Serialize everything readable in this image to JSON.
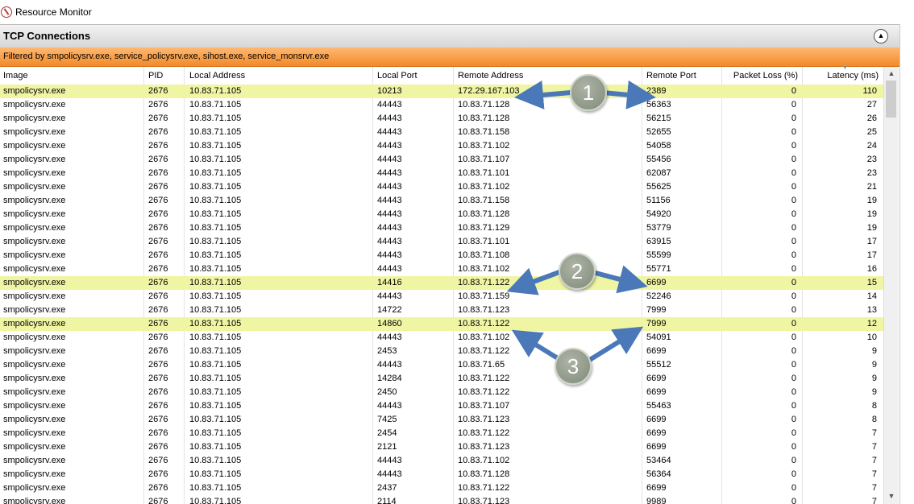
{
  "app": {
    "title": "Resource Monitor"
  },
  "section": {
    "title": "TCP Connections",
    "filter": "Filtered by smpolicysrv.exe, service_policysrv.exe, sihost.exe, service_monsrvr.exe"
  },
  "columns": [
    "Image",
    "PID",
    "Local Address",
    "Local Port",
    "Remote Address",
    "Remote Port",
    "Packet Loss (%)",
    "Latency (ms)"
  ],
  "rows": [
    {
      "image": "smpolicysrv.exe",
      "pid": "2676",
      "local_address": "10.83.71.105",
      "local_port": "10213",
      "remote_address": "172.29.167.103",
      "remote_port": "2389",
      "packet_loss": "0",
      "latency": "110",
      "highlighted": true
    },
    {
      "image": "smpolicysrv.exe",
      "pid": "2676",
      "local_address": "10.83.71.105",
      "local_port": "44443",
      "remote_address": "10.83.71.128",
      "remote_port": "56363",
      "packet_loss": "0",
      "latency": "27",
      "highlighted": false
    },
    {
      "image": "smpolicysrv.exe",
      "pid": "2676",
      "local_address": "10.83.71.105",
      "local_port": "44443",
      "remote_address": "10.83.71.128",
      "remote_port": "56215",
      "packet_loss": "0",
      "latency": "26",
      "highlighted": false
    },
    {
      "image": "smpolicysrv.exe",
      "pid": "2676",
      "local_address": "10.83.71.105",
      "local_port": "44443",
      "remote_address": "10.83.71.158",
      "remote_port": "52655",
      "packet_loss": "0",
      "latency": "25",
      "highlighted": false
    },
    {
      "image": "smpolicysrv.exe",
      "pid": "2676",
      "local_address": "10.83.71.105",
      "local_port": "44443",
      "remote_address": "10.83.71.102",
      "remote_port": "54058",
      "packet_loss": "0",
      "latency": "24",
      "highlighted": false
    },
    {
      "image": "smpolicysrv.exe",
      "pid": "2676",
      "local_address": "10.83.71.105",
      "local_port": "44443",
      "remote_address": "10.83.71.107",
      "remote_port": "55456",
      "packet_loss": "0",
      "latency": "23",
      "highlighted": false
    },
    {
      "image": "smpolicysrv.exe",
      "pid": "2676",
      "local_address": "10.83.71.105",
      "local_port": "44443",
      "remote_address": "10.83.71.101",
      "remote_port": "62087",
      "packet_loss": "0",
      "latency": "23",
      "highlighted": false
    },
    {
      "image": "smpolicysrv.exe",
      "pid": "2676",
      "local_address": "10.83.71.105",
      "local_port": "44443",
      "remote_address": "10.83.71.102",
      "remote_port": "55625",
      "packet_loss": "0",
      "latency": "21",
      "highlighted": false
    },
    {
      "image": "smpolicysrv.exe",
      "pid": "2676",
      "local_address": "10.83.71.105",
      "local_port": "44443",
      "remote_address": "10.83.71.158",
      "remote_port": "51156",
      "packet_loss": "0",
      "latency": "19",
      "highlighted": false
    },
    {
      "image": "smpolicysrv.exe",
      "pid": "2676",
      "local_address": "10.83.71.105",
      "local_port": "44443",
      "remote_address": "10.83.71.128",
      "remote_port": "54920",
      "packet_loss": "0",
      "latency": "19",
      "highlighted": false
    },
    {
      "image": "smpolicysrv.exe",
      "pid": "2676",
      "local_address": "10.83.71.105",
      "local_port": "44443",
      "remote_address": "10.83.71.129",
      "remote_port": "53779",
      "packet_loss": "0",
      "latency": "19",
      "highlighted": false
    },
    {
      "image": "smpolicysrv.exe",
      "pid": "2676",
      "local_address": "10.83.71.105",
      "local_port": "44443",
      "remote_address": "10.83.71.101",
      "remote_port": "63915",
      "packet_loss": "0",
      "latency": "17",
      "highlighted": false
    },
    {
      "image": "smpolicysrv.exe",
      "pid": "2676",
      "local_address": "10.83.71.105",
      "local_port": "44443",
      "remote_address": "10.83.71.108",
      "remote_port": "55599",
      "packet_loss": "0",
      "latency": "17",
      "highlighted": false
    },
    {
      "image": "smpolicysrv.exe",
      "pid": "2676",
      "local_address": "10.83.71.105",
      "local_port": "44443",
      "remote_address": "10.83.71.102",
      "remote_port": "55771",
      "packet_loss": "0",
      "latency": "16",
      "highlighted": false
    },
    {
      "image": "smpolicysrv.exe",
      "pid": "2676",
      "local_address": "10.83.71.105",
      "local_port": "14416",
      "remote_address": "10.83.71.122",
      "remote_port": "6699",
      "packet_loss": "0",
      "latency": "15",
      "highlighted": true
    },
    {
      "image": "smpolicysrv.exe",
      "pid": "2676",
      "local_address": "10.83.71.105",
      "local_port": "44443",
      "remote_address": "10.83.71.159",
      "remote_port": "52246",
      "packet_loss": "0",
      "latency": "14",
      "highlighted": false
    },
    {
      "image": "smpolicysrv.exe",
      "pid": "2676",
      "local_address": "10.83.71.105",
      "local_port": "14722",
      "remote_address": "10.83.71.123",
      "remote_port": "7999",
      "packet_loss": "0",
      "latency": "13",
      "highlighted": false
    },
    {
      "image": "smpolicysrv.exe",
      "pid": "2676",
      "local_address": "10.83.71.105",
      "local_port": "14860",
      "remote_address": "10.83.71.122",
      "remote_port": "7999",
      "packet_loss": "0",
      "latency": "12",
      "highlighted": true
    },
    {
      "image": "smpolicysrv.exe",
      "pid": "2676",
      "local_address": "10.83.71.105",
      "local_port": "44443",
      "remote_address": "10.83.71.102",
      "remote_port": "54091",
      "packet_loss": "0",
      "latency": "10",
      "highlighted": false
    },
    {
      "image": "smpolicysrv.exe",
      "pid": "2676",
      "local_address": "10.83.71.105",
      "local_port": "2453",
      "remote_address": "10.83.71.122",
      "remote_port": "6699",
      "packet_loss": "0",
      "latency": "9",
      "highlighted": false
    },
    {
      "image": "smpolicysrv.exe",
      "pid": "2676",
      "local_address": "10.83.71.105",
      "local_port": "44443",
      "remote_address": "10.83.71.65",
      "remote_port": "55512",
      "packet_loss": "0",
      "latency": "9",
      "highlighted": false
    },
    {
      "image": "smpolicysrv.exe",
      "pid": "2676",
      "local_address": "10.83.71.105",
      "local_port": "14284",
      "remote_address": "10.83.71.122",
      "remote_port": "6699",
      "packet_loss": "0",
      "latency": "9",
      "highlighted": false
    },
    {
      "image": "smpolicysrv.exe",
      "pid": "2676",
      "local_address": "10.83.71.105",
      "local_port": "2450",
      "remote_address": "10.83.71.122",
      "remote_port": "6699",
      "packet_loss": "0",
      "latency": "9",
      "highlighted": false
    },
    {
      "image": "smpolicysrv.exe",
      "pid": "2676",
      "local_address": "10.83.71.105",
      "local_port": "44443",
      "remote_address": "10.83.71.107",
      "remote_port": "55463",
      "packet_loss": "0",
      "latency": "8",
      "highlighted": false
    },
    {
      "image": "smpolicysrv.exe",
      "pid": "2676",
      "local_address": "10.83.71.105",
      "local_port": "7425",
      "remote_address": "10.83.71.123",
      "remote_port": "6699",
      "packet_loss": "0",
      "latency": "8",
      "highlighted": false
    },
    {
      "image": "smpolicysrv.exe",
      "pid": "2676",
      "local_address": "10.83.71.105",
      "local_port": "2454",
      "remote_address": "10.83.71.122",
      "remote_port": "6699",
      "packet_loss": "0",
      "latency": "7",
      "highlighted": false
    },
    {
      "image": "smpolicysrv.exe",
      "pid": "2676",
      "local_address": "10.83.71.105",
      "local_port": "2121",
      "remote_address": "10.83.71.123",
      "remote_port": "6699",
      "packet_loss": "0",
      "latency": "7",
      "highlighted": false
    },
    {
      "image": "smpolicysrv.exe",
      "pid": "2676",
      "local_address": "10.83.71.105",
      "local_port": "44443",
      "remote_address": "10.83.71.102",
      "remote_port": "53464",
      "packet_loss": "0",
      "latency": "7",
      "highlighted": false
    },
    {
      "image": "smpolicysrv.exe",
      "pid": "2676",
      "local_address": "10.83.71.105",
      "local_port": "44443",
      "remote_address": "10.83.71.128",
      "remote_port": "56364",
      "packet_loss": "0",
      "latency": "7",
      "highlighted": false
    },
    {
      "image": "smpolicysrv.exe",
      "pid": "2676",
      "local_address": "10.83.71.105",
      "local_port": "2437",
      "remote_address": "10.83.71.122",
      "remote_port": "6699",
      "packet_loss": "0",
      "latency": "7",
      "highlighted": false
    },
    {
      "image": "smpolicysrv.exe",
      "pid": "2676",
      "local_address": "10.83.71.105",
      "local_port": "2114",
      "remote_address": "10.83.71.123",
      "remote_port": "9989",
      "packet_loss": "0",
      "latency": "7",
      "highlighted": false
    }
  ],
  "callouts": [
    "1",
    "2",
    "3"
  ],
  "icons": {
    "app": "resource-monitor-icon",
    "collapse": "chevron-up-icon",
    "scroll_up": "scroll-up-arrow-icon",
    "scroll_down": "scroll-down-arrow-icon"
  },
  "colors": {
    "highlight_row": "#f0f5a4",
    "filter_bar": "#f28a28",
    "arrow": "#4a78b8",
    "callout": "#8f9a88"
  }
}
